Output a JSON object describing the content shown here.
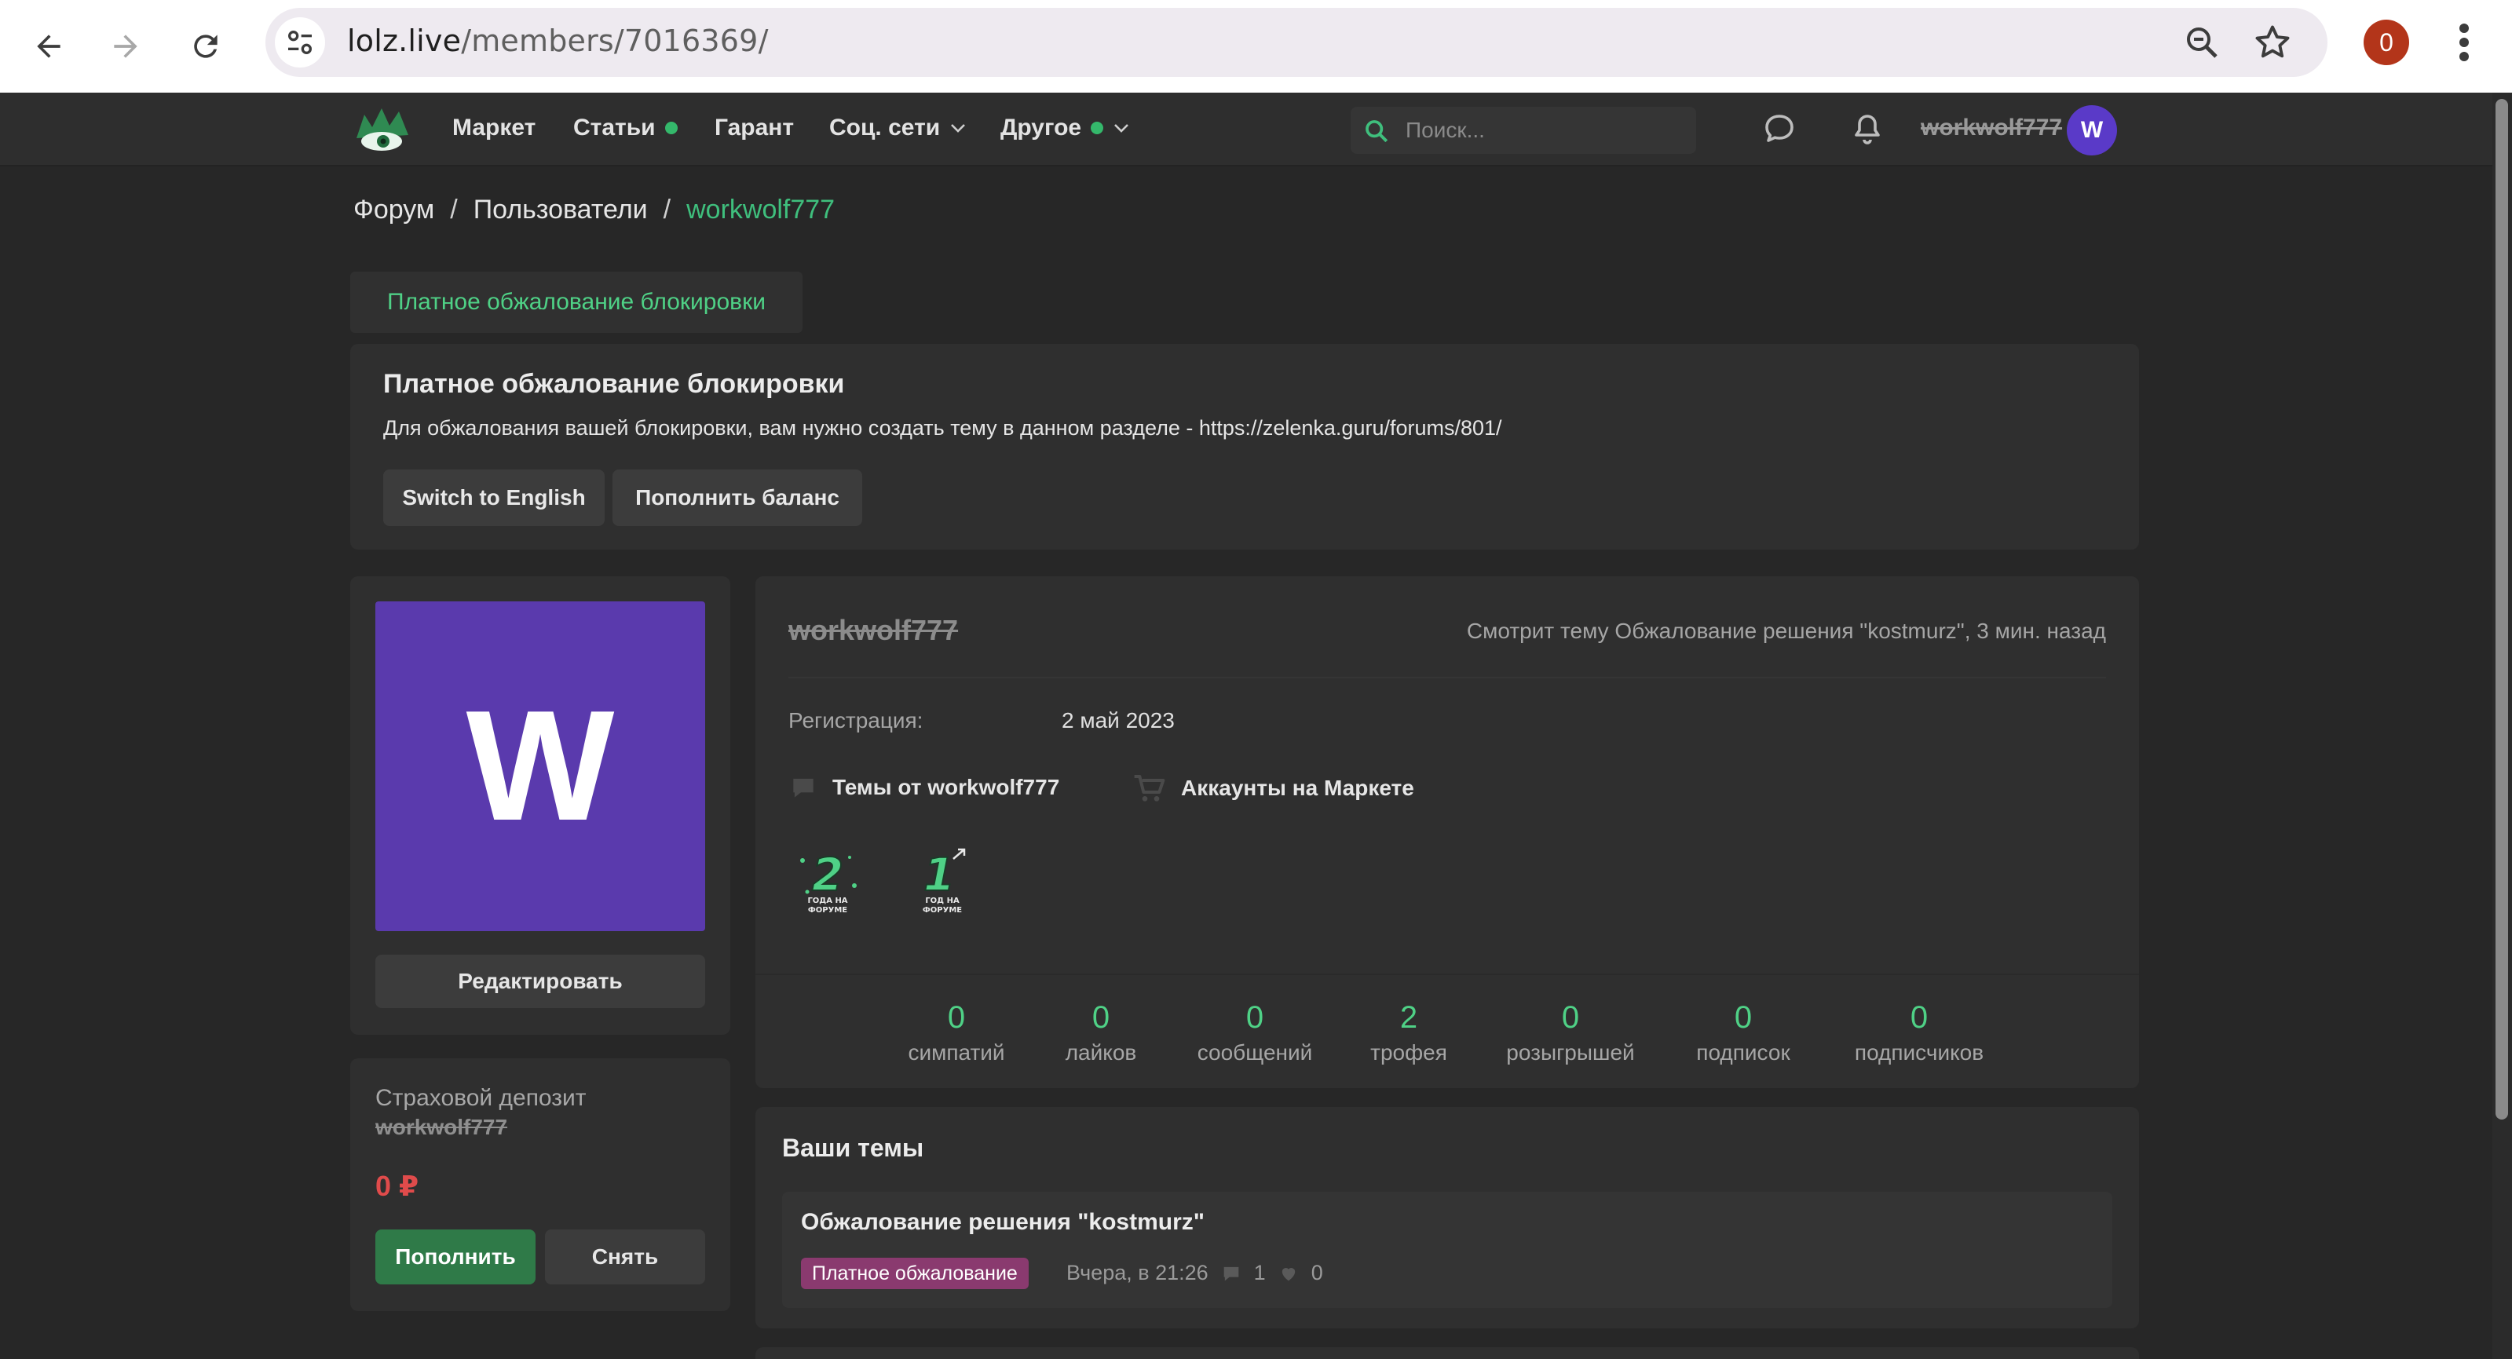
{
  "browser": {
    "url_host": "lolz.live",
    "url_path": "/members/7016369/",
    "profile_badge": "0",
    "colors": {
      "badge": "#b3351a"
    }
  },
  "header": {
    "nav": [
      {
        "label": "Маркет",
        "dot": false,
        "chevron": false
      },
      {
        "label": "Статьи",
        "dot": true,
        "chevron": false
      },
      {
        "label": "Гарант",
        "dot": false,
        "chevron": false
      },
      {
        "label": "Соц. сети",
        "dot": false,
        "chevron": true
      },
      {
        "label": "Другое",
        "dot": true,
        "chevron": true
      }
    ],
    "search_placeholder": "Поиск...",
    "username": "workwolf777",
    "avatar_letter": "W",
    "colors": {
      "accent": "#3fbf7d",
      "avatar": "#5a3ac8"
    }
  },
  "breadcrumb": {
    "items": [
      "Форум",
      "Пользователи"
    ],
    "current": "workwolf777",
    "separator": "/"
  },
  "notice": {
    "tag": "Платное обжалование блокировки",
    "title": "Платное обжалование блокировки",
    "text": "Для обжалования вашей блокировки, вам нужно создать тему в данном разделе - https://zelenka.guru/forums/801/",
    "buttons": [
      "Switch to English",
      "Пополнить баланс"
    ]
  },
  "avatar_card": {
    "letter": "W",
    "edit_label": "Редактировать"
  },
  "deposit": {
    "title": "Страховой депозит",
    "username": "workwolf777",
    "amount": "0 ₽",
    "deposit_label": "Пополнить",
    "withdraw_label": "Снять"
  },
  "profile": {
    "username": "workwolf777",
    "status": "Смотрит тему Обжалование решения \"kostmurz\", 3 мин. назад",
    "registration_label": "Регистрация:",
    "registration_value": "2 май 2023",
    "links": [
      "Темы от workwolf777",
      "Аккаунты на Маркете"
    ],
    "trophies": [
      {
        "number": "2",
        "caption_1": "ГОДА НА",
        "caption_2": "ФОРУМЕ"
      },
      {
        "number": "1",
        "caption_1": "ГОД НА",
        "caption_2": "ФОРУМЕ"
      }
    ],
    "stats": [
      {
        "value": "0",
        "label": "симпатий"
      },
      {
        "value": "0",
        "label": "лайков"
      },
      {
        "value": "0",
        "label": "сообщений"
      },
      {
        "value": "2",
        "label": "трофея"
      },
      {
        "value": "0",
        "label": "розыгрышей"
      },
      {
        "value": "0",
        "label": "подписок"
      },
      {
        "value": "0",
        "label": "подписчиков"
      }
    ]
  },
  "threads": {
    "heading": "Ваши темы",
    "items": [
      {
        "title": "Обжалование решения \"kostmurz\"",
        "prefix": "Платное обжалование",
        "date": "Вчера, в 21:26",
        "replies": "1",
        "likes": "0"
      }
    ]
  }
}
